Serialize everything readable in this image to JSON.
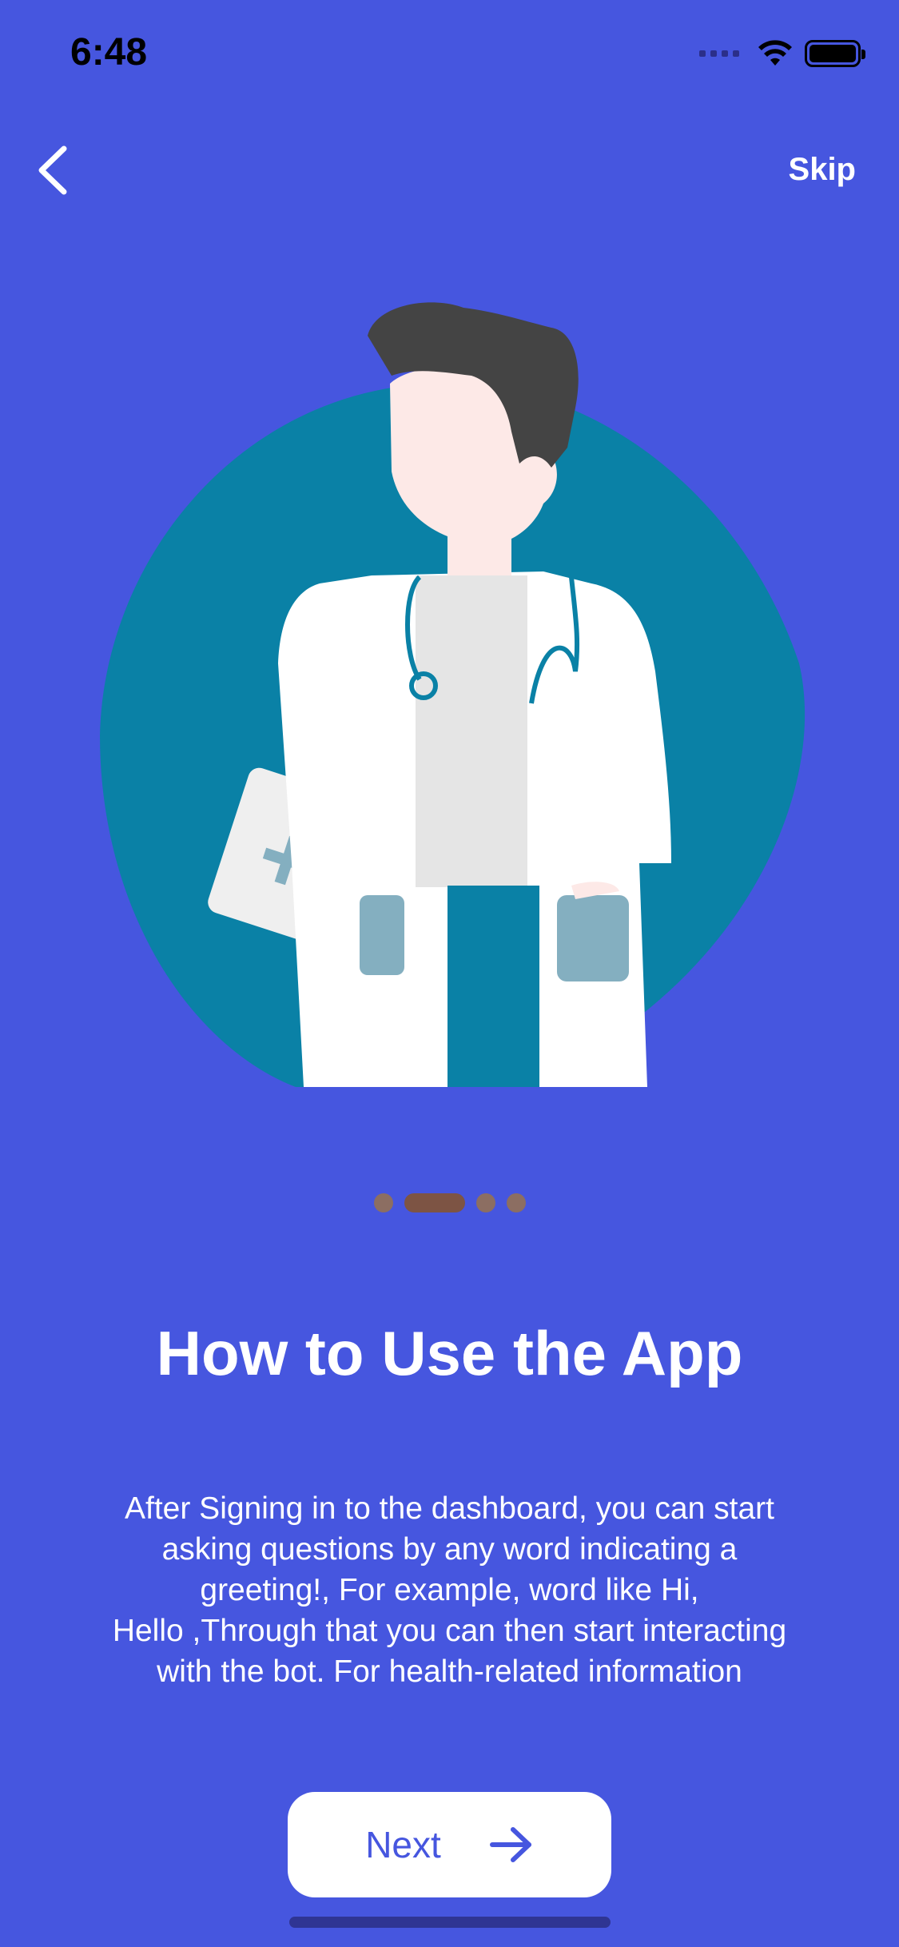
{
  "status_bar": {
    "time": "6:48"
  },
  "header": {
    "back_icon": "chevron-left-icon",
    "skip_label": "Skip"
  },
  "illustration": {
    "subject": "doctor-illustration",
    "colors": {
      "blob": "#0a81a6",
      "hair": "#444444",
      "skin": "#fde9e7",
      "coat": "#ffffff",
      "shirt": "#e5e5e5",
      "pocket": "#84afc0"
    }
  },
  "pager": {
    "count": 4,
    "active_index": 1
  },
  "content": {
    "title": "How to Use the App",
    "description_lines": [
      "After Signing in to the dashboard, you can start",
      "asking questions by any word indicating a",
      "greeting!, For example, word like Hi,",
      "Hello ,Through that you can then start interacting",
      "with the bot. For health-related information"
    ]
  },
  "footer": {
    "next_label": "Next",
    "next_icon": "arrow-right-icon"
  },
  "colors": {
    "background": "#4656df",
    "accent": "#4656df",
    "pager_dot": "#8c6e62",
    "pager_active": "#7d5444"
  }
}
